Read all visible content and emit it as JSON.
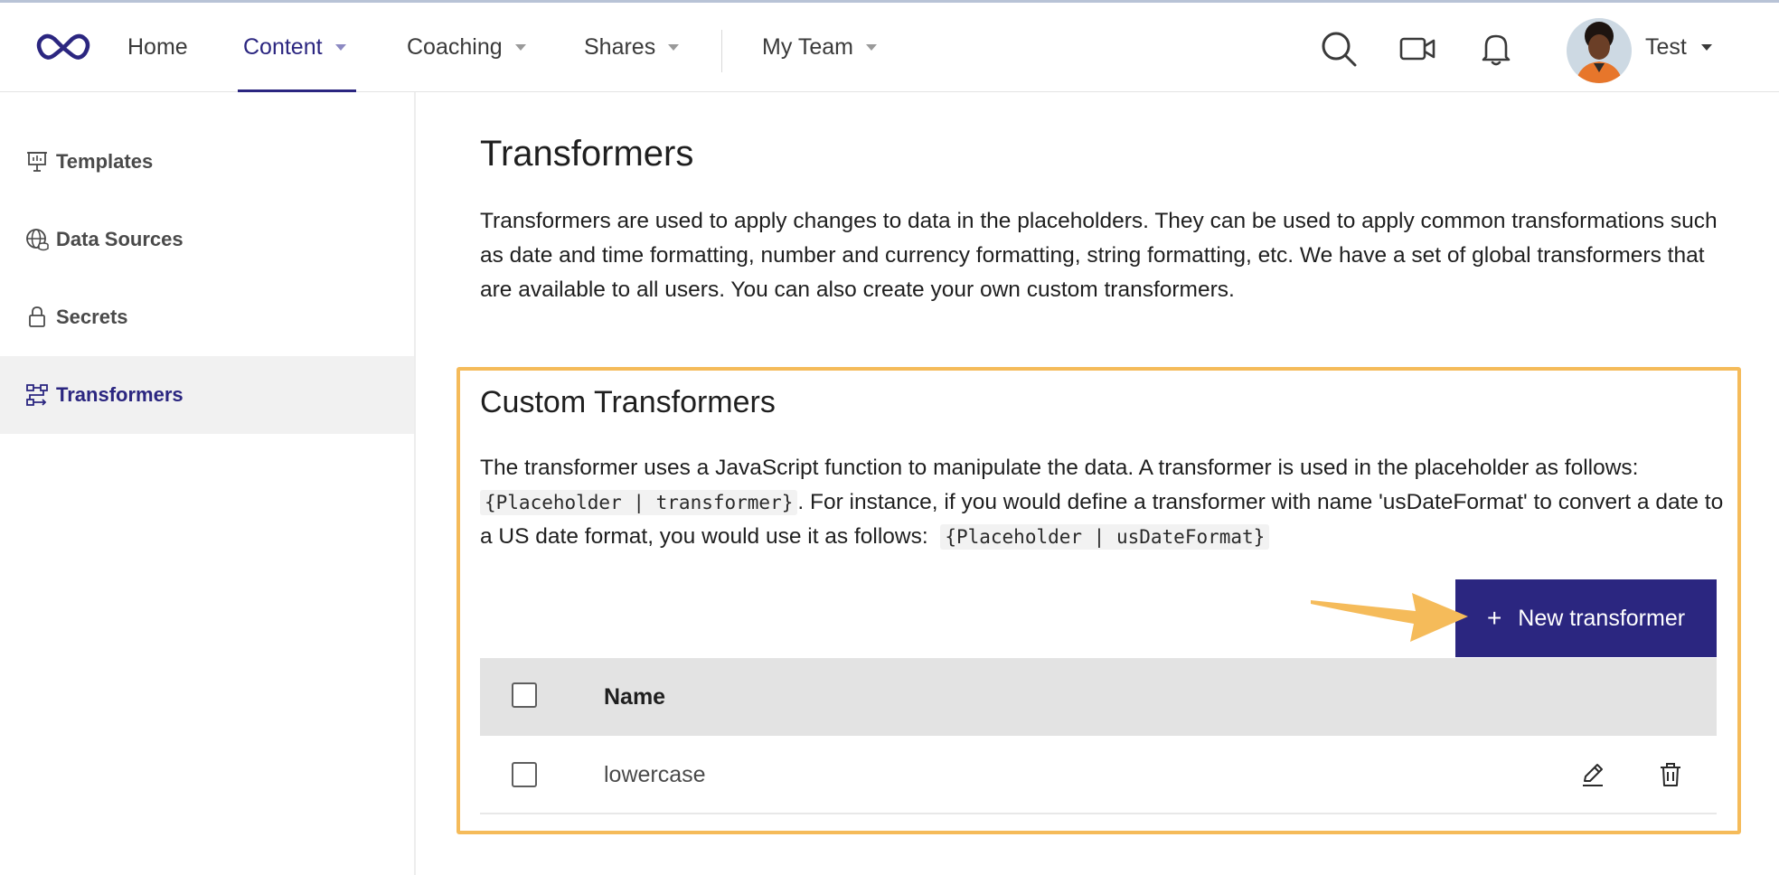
{
  "nav": {
    "home": "Home",
    "content": "Content",
    "coaching": "Coaching",
    "shares": "Shares",
    "my_team": "My Team",
    "user_name": "Test"
  },
  "icons": {
    "logo": "infinity-logo-icon",
    "search": "search-icon",
    "video": "video-camera-icon",
    "notifications": "bell-icon",
    "templates": "presentation-icon",
    "data_sources": "globe-database-icon",
    "secrets": "lock-icon",
    "transformers": "transform-flow-icon",
    "edit": "pencil-icon",
    "delete": "trash-icon"
  },
  "colors": {
    "accent": "#2b2680",
    "highlight": "#f5bb5a",
    "sidebar_active_bg": "#f1f1f1",
    "table_header_bg": "#e3e3e3"
  },
  "sidebar": {
    "items": [
      {
        "label": "Templates",
        "active": false
      },
      {
        "label": "Data Sources",
        "active": false
      },
      {
        "label": "Secrets",
        "active": false
      },
      {
        "label": "Transformers",
        "active": true
      }
    ]
  },
  "main": {
    "title": "Transformers",
    "description": "Transformers are used to apply changes to data in the placeholders. They can be used to apply common transformations such as date and time formatting, number and currency formatting, string formatting, etc. We have a set of global transformers that are available to all users. You can also create your own custom transformers."
  },
  "custom": {
    "title": "Custom Transformers",
    "desc_part1": "The transformer uses a JavaScript function to manipulate the data. A transformer is used in the placeholder as follows:",
    "code1": "{Placeholder | transformer}",
    "desc_part2": ". For instance, if you would define a transformer with name 'usDateFormat' to convert a date to a US date format, you would use it as follows:",
    "code2": "{Placeholder | usDateFormat}",
    "new_button_plus": "+",
    "new_button_label": "New transformer",
    "table": {
      "header_name": "Name",
      "rows": [
        {
          "name": "lowercase"
        }
      ]
    }
  }
}
